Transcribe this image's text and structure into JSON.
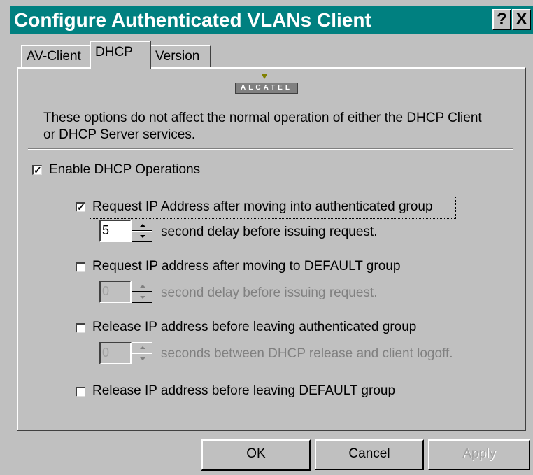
{
  "window": {
    "title": "Configure Authenticated VLANs Client",
    "help_label": "?",
    "close_label": "X"
  },
  "tabs": [
    {
      "label": "AV-Client"
    },
    {
      "label": "DHCP"
    },
    {
      "label": "Version"
    }
  ],
  "logo": {
    "text": "ALCATEL"
  },
  "description": {
    "line1": "These options do not affect the normal operation of either the DHCP Client",
    "line2": "or DHCP Server services."
  },
  "enable_dhcp": {
    "label": "Enable DHCP Operations",
    "checked": true
  },
  "options": [
    {
      "label": "Request IP Address after moving into authenticated group",
      "checked": true,
      "spin_value": "5",
      "spin_label": "second delay before issuing request.",
      "enabled": true
    },
    {
      "label": "Request IP address after moving to DEFAULT group",
      "checked": false,
      "spin_value": "0",
      "spin_label": "second delay before issuing request.",
      "enabled": false
    },
    {
      "label": "Release IP address before leaving authenticated group",
      "checked": false,
      "spin_value": "0",
      "spin_label": "seconds between DHCP release and client logoff.",
      "enabled": false
    },
    {
      "label": "Release IP address before leaving DEFAULT group",
      "checked": false
    }
  ],
  "buttons": {
    "ok": "OK",
    "cancel": "Cancel",
    "apply": "Apply"
  },
  "check_glyph": "✓"
}
